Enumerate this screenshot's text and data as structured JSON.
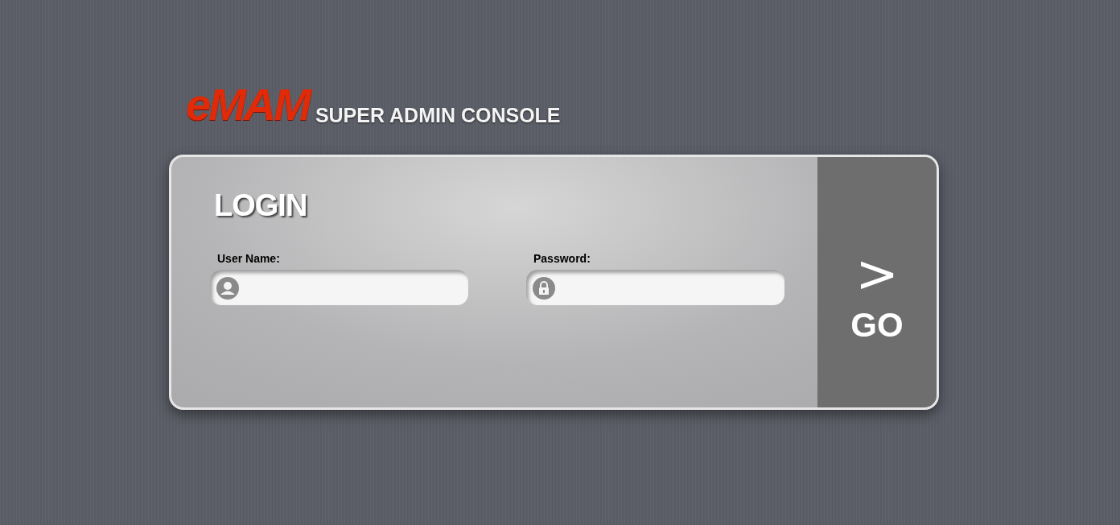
{
  "logo": {
    "brand": "eMAM",
    "subtitle": "SUPER ADMIN CONSOLE"
  },
  "login": {
    "title": "LOGIN",
    "fields": [
      {
        "kind": "user",
        "label": "User Name:"
      },
      {
        "kind": "password",
        "label": "Password:"
      }
    ],
    "go_button": {
      "arrow": ">",
      "label": "GO"
    }
  }
}
